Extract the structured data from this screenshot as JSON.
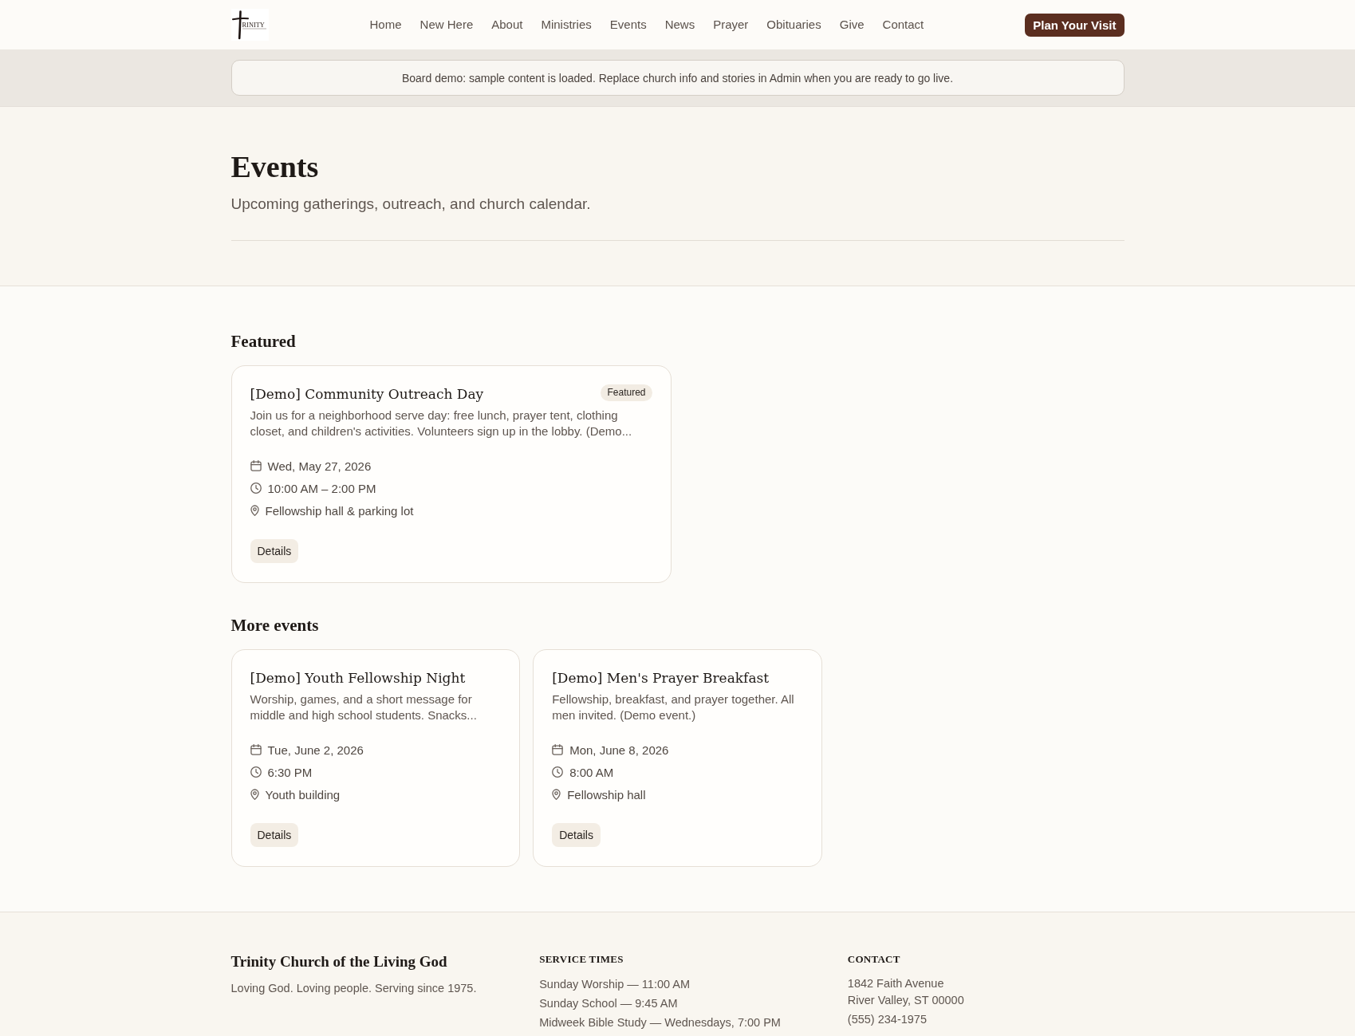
{
  "header": {
    "logo": {
      "wordmark": "RINITY"
    },
    "nav": [
      "Home",
      "New Here",
      "About",
      "Ministries",
      "Events",
      "News",
      "Prayer",
      "Obituaries",
      "Give",
      "Contact"
    ],
    "cta": "Plan Your Visit"
  },
  "notice": "Board demo: sample content is loaded. Replace church info and stories in Admin when you are ready to go live.",
  "page": {
    "title": "Events",
    "subtitle": "Upcoming gatherings, outreach, and church calendar."
  },
  "featured": {
    "heading": "Featured",
    "events": [
      {
        "title": "[Demo] Community Outreach Day",
        "badge": "Featured",
        "description": "Join us for a neighborhood serve day: free lunch, prayer tent, clothing closet, and children's activities. Volunteers sign up in the lobby. (Demo...",
        "details": [
          {
            "kind": "date",
            "text": "Wed, May 27, 2026"
          },
          {
            "kind": "time",
            "text": "10:00 AM – 2:00 PM"
          },
          {
            "kind": "location",
            "text": "Fellowship hall & parking lot"
          }
        ],
        "button": "Details"
      }
    ]
  },
  "more_events": {
    "heading": "More events",
    "events": [
      {
        "title": "[Demo] Youth Fellowship Night",
        "description": "Worship, games, and a short message for middle and high school students. Snacks...",
        "details": [
          {
            "kind": "date",
            "text": "Tue, June 2, 2026"
          },
          {
            "kind": "time",
            "text": "6:30 PM"
          },
          {
            "kind": "location",
            "text": "Youth building"
          }
        ],
        "button": "Details"
      },
      {
        "title": "[Demo] Men's Prayer Breakfast",
        "description": "Fellowship, breakfast, and prayer together. All men invited. (Demo event.)",
        "details": [
          {
            "kind": "date",
            "text": "Mon, June 8, 2026"
          },
          {
            "kind": "time",
            "text": "8:00 AM"
          },
          {
            "kind": "location",
            "text": "Fellowship hall"
          }
        ],
        "button": "Details"
      }
    ]
  },
  "footer": {
    "name": "Trinity Church of the Living God",
    "tagline": "Loving God. Loving people. Serving since 1975.",
    "service_times": {
      "heading": "SERVICE TIMES",
      "items": [
        "Sunday Worship — 11:00 AM",
        "Sunday School — 9:45 AM",
        "Midweek Bible Study — Wednesdays, 7:00 PM"
      ]
    },
    "contact": {
      "heading": "CONTACT",
      "address": [
        "1842 Faith Avenue",
        "River Valley, ST 00000"
      ],
      "phone": "(555) 234-1975"
    }
  }
}
